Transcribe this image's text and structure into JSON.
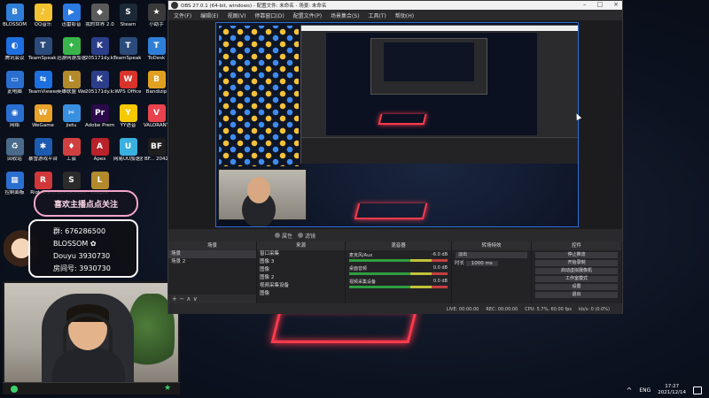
{
  "desktop": {
    "icons": [
      {
        "label": "BLOSSOM",
        "color": "#2f7fd8",
        "glyph": "B"
      },
      {
        "label": "QQ音乐",
        "color": "#f2c230",
        "glyph": "♪"
      },
      {
        "label": "迅雷影音",
        "color": "#2a7ae2",
        "glyph": "▶"
      },
      {
        "label": "我的世界 2.0",
        "color": "#5a5a5a",
        "glyph": "◆"
      },
      {
        "label": "Steam",
        "color": "#1b2838",
        "glyph": "S"
      },
      {
        "label": "小助手",
        "color": "#3a3a3a",
        "glyph": "★"
      },
      {
        "label": "腾讯会议",
        "color": "#1e6fe0",
        "glyph": "◐"
      },
      {
        "label": "TeamSpeak 3 Client",
        "color": "#2b4b7a",
        "glyph": "T"
      },
      {
        "label": "迅游网游加速器",
        "color": "#3ab44a",
        "glyph": "✦"
      },
      {
        "label": "205171dy.kx",
        "color": "#2c3e8a",
        "glyph": "K"
      },
      {
        "label": "TeamSpeak 3",
        "color": "#2b4b7a",
        "glyph": "T"
      },
      {
        "label": "ToDesk",
        "color": "#2f7fd8",
        "glyph": "T"
      },
      {
        "label": "此电脑",
        "color": "#2a6fd0",
        "glyph": "▭"
      },
      {
        "label": "TeamViewer",
        "color": "#1c70e0",
        "glyph": "⇆"
      },
      {
        "label": "英雄联盟 WeGame版",
        "color": "#b28a2c",
        "glyph": "L"
      },
      {
        "label": "205171dy.kx - 快捷方式",
        "color": "#2c3e8a",
        "glyph": "K"
      },
      {
        "label": "WPS Office",
        "color": "#d9342b",
        "glyph": "W"
      },
      {
        "label": "Bandizip",
        "color": "#e0a020",
        "glyph": "B"
      },
      {
        "label": "网络",
        "color": "#2a6fd0",
        "glyph": "◉"
      },
      {
        "label": "WeGame",
        "color": "#e8a22a",
        "glyph": "W"
      },
      {
        "label": "jietu",
        "color": "#3a90e0",
        "glyph": "✂"
      },
      {
        "label": "Adobe Premiere ...",
        "color": "#2a0a4a",
        "glyph": "Pr"
      },
      {
        "label": "YY语音",
        "color": "#f5c800",
        "glyph": "Y"
      },
      {
        "label": "VALORANT",
        "color": "#e8434f",
        "glyph": "V"
      },
      {
        "label": "回收站",
        "color": "#4a6a8a",
        "glyph": "♻"
      },
      {
        "label": "暴雪游戏平台",
        "color": "#1c5bb0",
        "glyph": "✱"
      },
      {
        "label": "工会",
        "color": "#d04040",
        "glyph": "♦"
      },
      {
        "label": "Apex",
        "color": "#b8222a",
        "glyph": "A"
      },
      {
        "label": "网易UU加速器",
        "color": "#3ab0e0",
        "glyph": "U"
      },
      {
        "label": "BF... 2042",
        "color": "#1e1e1e",
        "glyph": "BF"
      },
      {
        "label": "控制面板",
        "color": "#2a6fd0",
        "glyph": "▦"
      },
      {
        "label": "Riot Client",
        "color": "#d13639",
        "glyph": "R"
      },
      {
        "label": "SUPER PEOPLE CBT",
        "color": "#2b2b2b",
        "glyph": "S"
      },
      {
        "label": "League",
        "color": "#b28a2c",
        "glyph": "L"
      }
    ]
  },
  "overlay": {
    "pink_badge": "喜欢主播点点关注",
    "info_lines": [
      "群: 676286500",
      "BLOSSOM ✿",
      "Douyu 3930730",
      "房间号: 3930730"
    ]
  },
  "obs": {
    "title": "OBS 27.0.1 (64-bit, windows) - 配置文件: 未命名 - 场景: 未命名",
    "menu": [
      "文件(F)",
      "编辑(E)",
      "视图(V)",
      "停靠窗口(D)",
      "配置文件(P)",
      "场景集合(S)",
      "工具(T)",
      "帮助(H)"
    ],
    "source_toolbar": [
      "属性",
      "滤镜"
    ],
    "docks": {
      "scenes": {
        "header": "场景",
        "items": [
          "场景",
          "场景 2"
        ]
      },
      "sources": {
        "header": "来源",
        "items": [
          "窗口采集",
          "图像 3",
          "图像",
          "图像 2",
          "视频采集设备",
          "图像"
        ]
      },
      "mixer": {
        "header": "混音器",
        "rows": [
          {
            "name": "麦克风/Aux",
            "db": "-6.0 dB"
          },
          {
            "name": "桌面音频",
            "db": "0.0 dB"
          },
          {
            "name": "视频采集设备",
            "db": "0.0 dB"
          }
        ]
      },
      "transitions": {
        "header": "转场特效",
        "type": "淡出",
        "duration_label": "时长",
        "duration": "1000 ms"
      },
      "controls": {
        "header": "控件",
        "buttons": [
          "停止推流",
          "开始录制",
          "启动虚拟摄像机",
          "工作室模式",
          "设置",
          "退出"
        ]
      }
    },
    "status": [
      "LIVE: 00:00:00",
      "REC: 00:00:00",
      "CPU: 5.7%, 60.00 fps",
      "kb/s: 0 (0.0%)"
    ]
  },
  "taskbar": {
    "lang": "ENG",
    "time": "17:27",
    "date": "2021/12/14"
  }
}
